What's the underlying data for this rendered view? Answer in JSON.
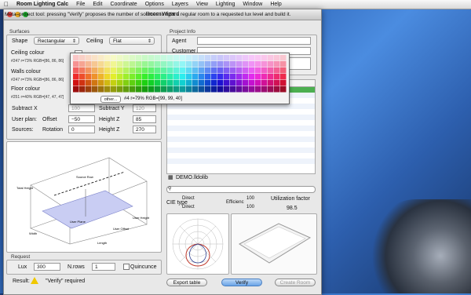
{
  "menubar": {
    "apple": "",
    "items": [
      "Room Lighting Calc",
      "File",
      "Edit",
      "Coordinate",
      "Options",
      "Layers",
      "View",
      "Lighting",
      "Window",
      "Help"
    ]
  },
  "window": {
    "title": "Room Wizard"
  },
  "hint": "Meta–project tool: pressing \"Verify\" proposes the number of sources to light a regular room to a requested lux level and build it.",
  "surfaces": {
    "label": "Surfaces",
    "shape_label": "Shape",
    "shape_value": "Rectangular",
    "ceiling_label": "Ceiling",
    "ceiling_value": "Flat",
    "ceiling_colour": {
      "title": "Ceiling colour",
      "value": "#247 r=73% RGB=[86, 86, 86]"
    },
    "walls_colour": {
      "title": "Walls colour",
      "value": "#247 r=73% RGB=[86, 86, 86]"
    },
    "floor_colour": {
      "title": "Floor colour",
      "value": "#251 r=40% RGB=[47, 47, 47]"
    },
    "subtract_x_label": "Subtract X",
    "subtract_x_value": "100",
    "subtract_y_label": "Subtract Y",
    "subtract_y_value": "120",
    "userplan_label": "User plan:",
    "offset_label": "Offset",
    "offset_value": "−50",
    "height_z_label": "Height Z",
    "height_z_value": "85",
    "sources_label": "Sources:",
    "rotation_label": "Rotation",
    "rotation_value": "0",
    "height_z2_label": "Height Z",
    "height_z2_value": "270"
  },
  "diagram": {
    "total_height": "Total Height",
    "source_row": "Source Row",
    "width": "Width",
    "length": "Length",
    "user_plane": "User Plane",
    "user_height": "User Height",
    "user_offset": "User Offset"
  },
  "request": {
    "label": "Request",
    "lux_label": "Lux",
    "lux_value": "300",
    "nrows_label": "N.rows",
    "nrows_value": "1",
    "quincunce_label": "Quincunce"
  },
  "result": {
    "label": "Result:",
    "text": "\"Verify\" required"
  },
  "project": {
    "label": "Project Info",
    "agent_label": "Agent",
    "customer_label": "Customer"
  },
  "library": {
    "file": "DEMO.lldolib",
    "cie_label": "CIE type",
    "direct1": "Direct",
    "direct2": "Direct",
    "val1": "100",
    "val2": "100",
    "efficiency_label": "Efficienc",
    "util_label": "Utilization factor",
    "util_value": "98.5"
  },
  "buttons": {
    "export": "Export table",
    "verify": "Verify",
    "create": "Create Room"
  },
  "palette": {
    "other": "other...",
    "info": "#4 r=79% RGB=[99, 99, 40]",
    "warning_color": "#f0c800"
  }
}
